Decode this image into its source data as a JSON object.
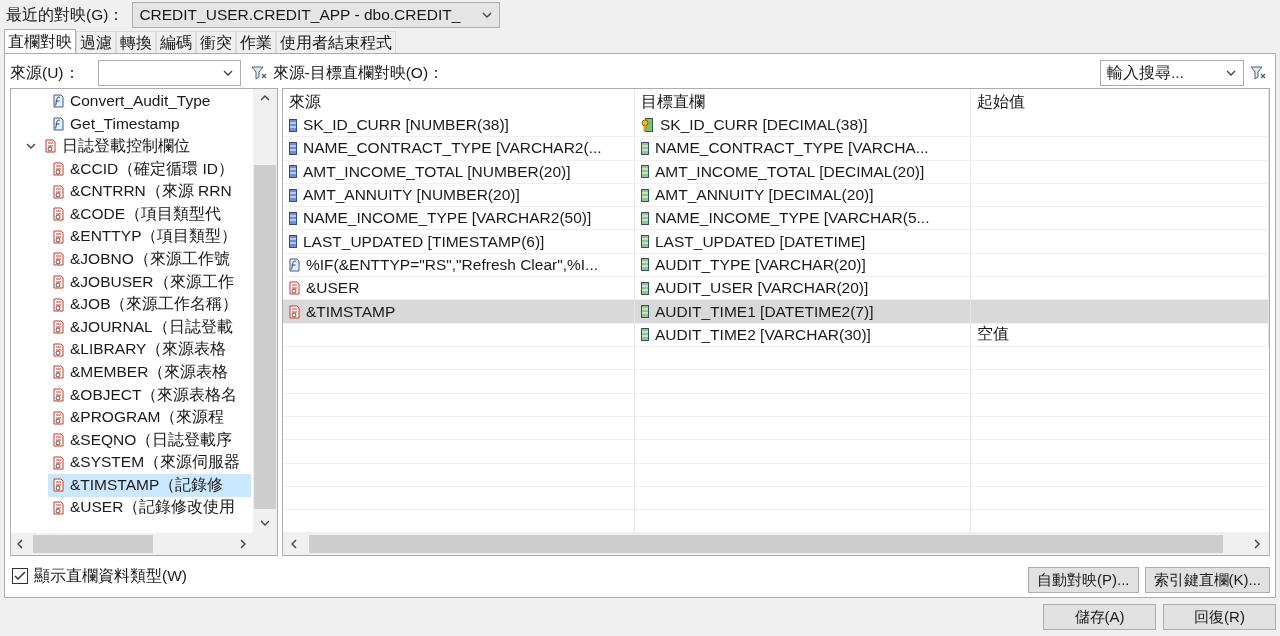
{
  "recent_mapping": {
    "label": "最近的對映(G)：",
    "value": "CREDIT_USER.CREDIT_APP - dbo.CREDIT_"
  },
  "tabs": [
    {
      "label": "直欄對映",
      "selected": true
    },
    {
      "label": "過濾",
      "selected": false
    },
    {
      "label": "轉換",
      "selected": false
    },
    {
      "label": "編碼",
      "selected": false
    },
    {
      "label": "衝突",
      "selected": false
    },
    {
      "label": "作業",
      "selected": false
    },
    {
      "label": "使用者結束程式",
      "selected": false
    }
  ],
  "source_filter": {
    "label": "來源(U)："
  },
  "mapping_label": "來源-目標直欄對映(O)：",
  "search": {
    "placeholder": "輸入搜尋..."
  },
  "source_tree": [
    {
      "kind": "function",
      "label": "Convert_Audit_Type",
      "selected": false
    },
    {
      "kind": "function",
      "label": "Get_Timestamp",
      "selected": false
    },
    {
      "kind": "group",
      "label": "日誌登載控制欄位",
      "expanded": true,
      "selected": false,
      "children": [
        {
          "kind": "variable",
          "label": "&CCID（確定循環 ID）",
          "selected": false
        },
        {
          "kind": "variable",
          "label": "&CNTRRN（來源 RRN",
          "selected": false
        },
        {
          "kind": "variable",
          "label": "&CODE（項目類型代",
          "selected": false
        },
        {
          "kind": "variable",
          "label": "&ENTTYP（項目類型）",
          "selected": false
        },
        {
          "kind": "variable",
          "label": "&JOBNO（來源工作號",
          "selected": false
        },
        {
          "kind": "variable",
          "label": "&JOBUSER（來源工作",
          "selected": false
        },
        {
          "kind": "variable",
          "label": "&JOB（來源工作名稱）",
          "selected": false
        },
        {
          "kind": "variable",
          "label": "&JOURNAL（日誌登載",
          "selected": false
        },
        {
          "kind": "variable",
          "label": "&LIBRARY（來源表格",
          "selected": false
        },
        {
          "kind": "variable",
          "label": "&MEMBER（來源表格",
          "selected": false
        },
        {
          "kind": "variable",
          "label": "&OBJECT（來源表格名",
          "selected": false
        },
        {
          "kind": "variable",
          "label": "&PROGRAM（來源程",
          "selected": false
        },
        {
          "kind": "variable",
          "label": "&SEQNO（日誌登載序",
          "selected": false
        },
        {
          "kind": "variable",
          "label": "&SYSTEM（來源伺服器",
          "selected": false
        },
        {
          "kind": "variable",
          "label": "&TIMSTAMP（記錄修",
          "selected": true
        },
        {
          "kind": "variable",
          "label": "&USER（記錄修改使用",
          "selected": false
        }
      ]
    }
  ],
  "table": {
    "columns": [
      "來源",
      "目標直欄",
      "起始值"
    ],
    "rows": [
      {
        "selected": false,
        "source": {
          "kind": "column",
          "text": "SK_ID_CURR [NUMBER(38)]"
        },
        "target": {
          "kind": "key",
          "text": "SK_ID_CURR [DECIMAL(38)]"
        }
      },
      {
        "selected": false,
        "source": {
          "kind": "column",
          "text": "NAME_CONTRACT_TYPE [VARCHAR2(..."
        },
        "target": {
          "kind": "column",
          "text": "NAME_CONTRACT_TYPE [VARCHA..."
        }
      },
      {
        "selected": false,
        "source": {
          "kind": "column",
          "text": "AMT_INCOME_TOTAL [NUMBER(20)]"
        },
        "target": {
          "kind": "column",
          "text": "AMT_INCOME_TOTAL [DECIMAL(20)]"
        }
      },
      {
        "selected": false,
        "source": {
          "kind": "column",
          "text": "AMT_ANNUITY [NUMBER(20)]"
        },
        "target": {
          "kind": "column",
          "text": "AMT_ANNUITY [DECIMAL(20)]"
        }
      },
      {
        "selected": false,
        "source": {
          "kind": "column",
          "text": "NAME_INCOME_TYPE [VARCHAR2(50)]"
        },
        "target": {
          "kind": "column",
          "text": "NAME_INCOME_TYPE [VARCHAR(5..."
        }
      },
      {
        "selected": false,
        "source": {
          "kind": "column",
          "text": "LAST_UPDATED [TIMESTAMP(6)]"
        },
        "target": {
          "kind": "column",
          "text": "LAST_UPDATED [DATETIME]"
        }
      },
      {
        "selected": false,
        "source": {
          "kind": "expression",
          "text": "%IF(&ENTTYP=\"RS\",\"Refresh Clear\",%I..."
        },
        "target": {
          "kind": "column",
          "text": "AUDIT_TYPE [VARCHAR(20)]"
        }
      },
      {
        "selected": false,
        "source": {
          "kind": "variable",
          "text": "&USER"
        },
        "target": {
          "kind": "column",
          "text": "AUDIT_USER [VARCHAR(20)]"
        }
      },
      {
        "selected": true,
        "source": {
          "kind": "variable",
          "text": "&TIMSTAMP"
        },
        "target": {
          "kind": "column",
          "text": "AUDIT_TIME1 [DATETIME2(7)]"
        }
      },
      {
        "selected": false,
        "target": {
          "kind": "column",
          "text": "AUDIT_TIME2 [VARCHAR(30)]"
        },
        "initial_value": "空值"
      }
    ]
  },
  "show_data_types": {
    "label": "顯示直欄資料類型(W)",
    "checked": true
  },
  "buttons": [
    "自動對映(P)...",
    "索引鍵直欄(K)..."
  ],
  "footer_buttons": [
    "儲存(A)",
    "回復(R)"
  ]
}
